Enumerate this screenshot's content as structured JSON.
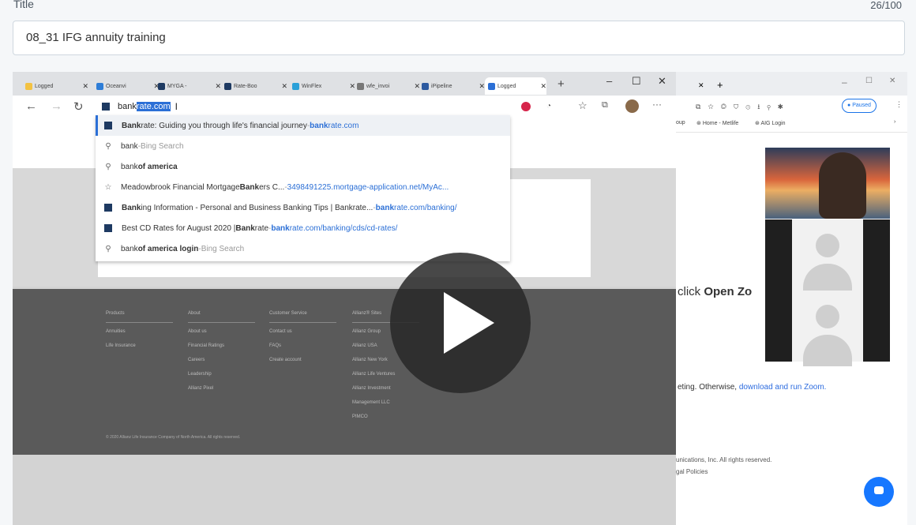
{
  "form": {
    "title_label": "Title",
    "char_count": "26/100",
    "title_value": "08_31 IFG annuity training"
  },
  "video": {
    "tabs": [
      {
        "label": "Logged"
      },
      {
        "label": "Oceanvi"
      },
      {
        "label": "MYGA -"
      },
      {
        "label": "Rate-Boo"
      },
      {
        "label": "WinFlex"
      },
      {
        "label": "wfe_invoi"
      },
      {
        "label": "iPipeline"
      },
      {
        "label": "Logged"
      }
    ],
    "url_typed": "bank",
    "url_completion": "rate.com",
    "suggestions": [
      {
        "icon": "bankrate-favicon",
        "bold": "Bank",
        "text": "rate: Guiding you through life's financial journey",
        "sep": " - ",
        "url_bold": "bank",
        "url": "rate.com"
      },
      {
        "icon": "search-icon",
        "bold": "",
        "text": "bank",
        "sep": " - ",
        "muted": "Bing Search"
      },
      {
        "icon": "search-icon",
        "bold": "",
        "text": "bank ",
        "strong": "of america"
      },
      {
        "icon": "star-icon",
        "text": "Meadowbrook Financial Mortgage ",
        "strong": "Bank",
        "text2": "ers C...",
        "sep": " - ",
        "url": "3498491225.mortgage-application.net/MyAc..."
      },
      {
        "icon": "bankrate-favicon",
        "bold": "Bank",
        "text": "ing Information - Personal and Business Banking Tips | Bankrate...",
        "sep": " - ",
        "url_bold": "bank",
        "url": "rate.com/banking/"
      },
      {
        "icon": "bankrate-favicon",
        "text": "Best CD Rates for August 2020 | ",
        "strong": "Bank",
        "text2": "rate",
        "sep": " - ",
        "url_bold": "bank",
        "url": "rate.com/banking/cds/cd-rates/"
      },
      {
        "icon": "search-icon",
        "text": "bank ",
        "strong": "of america login",
        "sep": " - ",
        "muted": "Bing Search"
      }
    ],
    "footer_columns": [
      {
        "head": "Products",
        "items": [
          "Annuities",
          "Life Insurance"
        ]
      },
      {
        "head": "About",
        "items": [
          "About us",
          "Financial Ratings",
          "Careers",
          "Leadership",
          "Allianz Pixel"
        ]
      },
      {
        "head": "Customer Service",
        "items": [
          "Contact us",
          "FAQs",
          "Create account"
        ]
      },
      {
        "head": "Allianz® Sites",
        "items": [
          "Allianz Group",
          "Allianz USA",
          "Allianz New York",
          "Allianz Life Ventures",
          "Allianz Investment Management LLC",
          "PIMCO"
        ]
      }
    ],
    "footer_copyright": "© 2020 Allianz Life Insurance Company of North America. All rights reserved.",
    "right_panel": {
      "bookmarks": [
        "Home - Metlife",
        "AIG Login"
      ],
      "paused_label": "Paused",
      "open_zoom_prefix": "click ",
      "open_zoom_bold": "Open Zo",
      "meeting_suffix": "eting. Otherwise, ",
      "download_link": "download and run Zoom.",
      "rights": "unications, Inc. All rights reserved.",
      "legal": "gal Policies"
    }
  }
}
